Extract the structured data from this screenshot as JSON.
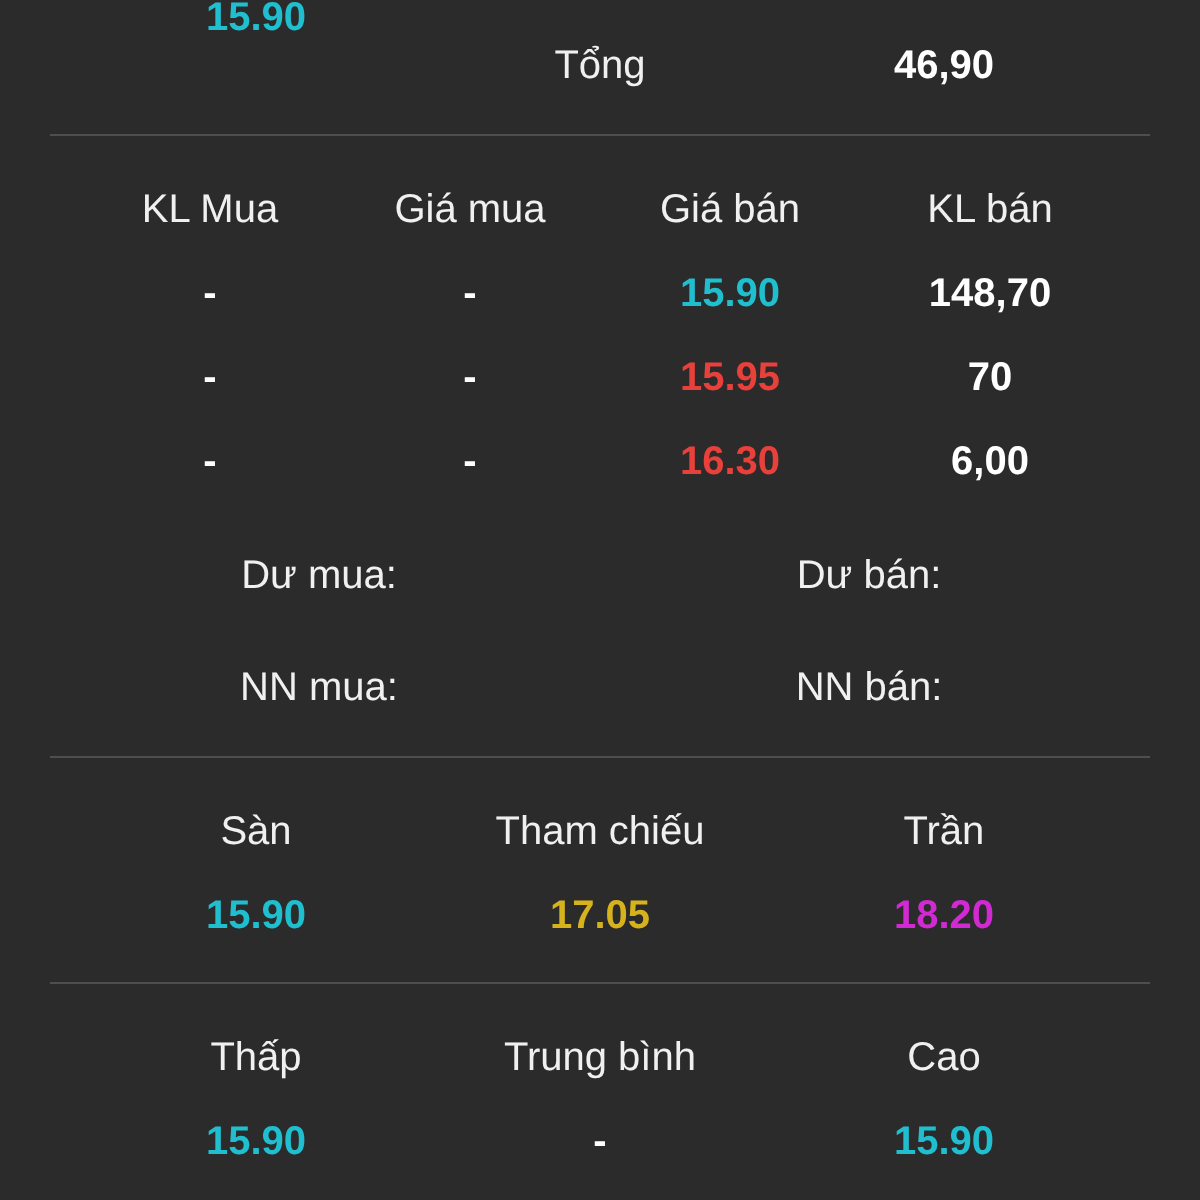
{
  "top_value": {
    "text": "15.90",
    "color": "#20bfd0"
  },
  "total": {
    "label": "Tổng",
    "value": "46,90"
  },
  "order_book": {
    "columns": [
      "KL Mua",
      "Giá mua",
      "Giá bán",
      "KL bán"
    ],
    "rows": [
      {
        "buy_volume": "-",
        "buy_price": "-",
        "sell_price": {
          "text": "15.90",
          "color": "#20bfd0"
        },
        "sell_volume": "148,70"
      },
      {
        "buy_volume": "-",
        "buy_price": "-",
        "sell_price": {
          "text": "15.95",
          "color": "#e8403b"
        },
        "sell_volume": "70"
      },
      {
        "buy_volume": "-",
        "buy_price": "-",
        "sell_price": {
          "text": "16.30",
          "color": "#e8403b"
        },
        "sell_volume": "6,00"
      }
    ]
  },
  "balances": [
    {
      "label": "Dư mua:"
    },
    {
      "label": "Dư bán:"
    },
    {
      "label": "NN mua:"
    },
    {
      "label": "NN bán:"
    }
  ],
  "reference_prices": [
    {
      "label": "Sàn",
      "value": "15.90",
      "color": "#20bfd0"
    },
    {
      "label": "Tham chiếu",
      "value": "17.05",
      "color": "#d6b31c"
    },
    {
      "label": "Trần",
      "value": "18.20",
      "color": "#d22ad2"
    }
  ],
  "session_prices": [
    {
      "label": "Thấp",
      "value": "15.90",
      "color": "#20bfd0"
    },
    {
      "label": "Trung bình",
      "value": "-",
      "color": "#ffffff"
    },
    {
      "label": "Cao",
      "value": "15.90",
      "color": "#20bfd0"
    }
  ]
}
